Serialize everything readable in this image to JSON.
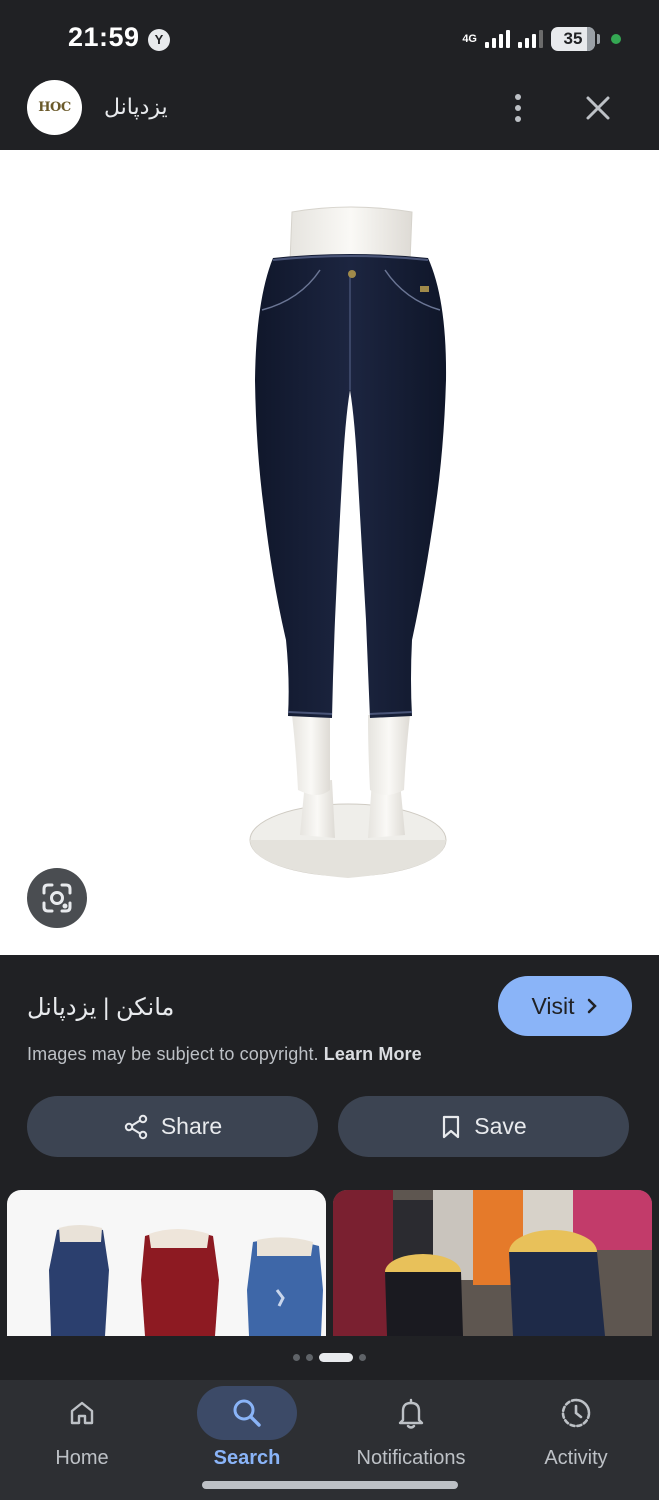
{
  "status_bar": {
    "time": "21:59",
    "notification_badge": "Y",
    "network": "4G",
    "battery": "35"
  },
  "header": {
    "logo_text": "HOC",
    "site_name": "یزدپانل",
    "menu_icon": "more-vert-icon",
    "close_icon": "close-icon"
  },
  "image": {
    "subject": "jeans-on-mannequin",
    "lens_icon": "google-lens-icon"
  },
  "result": {
    "title": "مانکن | یزدپانل",
    "visit_label": "Visit",
    "copyright_text": "Images may be subject to copyright.",
    "learn_more": "Learn More",
    "share_label": "Share",
    "save_label": "Save"
  },
  "carousel": {
    "dots": 4,
    "active_index": 2
  },
  "bottom_nav": {
    "items": [
      {
        "label": "Home",
        "icon": "home-icon"
      },
      {
        "label": "Search",
        "icon": "search-icon",
        "active": true
      },
      {
        "label": "Notifications",
        "icon": "bell-icon"
      },
      {
        "label": "Activity",
        "icon": "history-icon"
      }
    ]
  },
  "colors": {
    "background": "#202124",
    "accent": "#8ab4f8",
    "pill": "#3c4452",
    "nav_bg": "#2d2f33"
  }
}
